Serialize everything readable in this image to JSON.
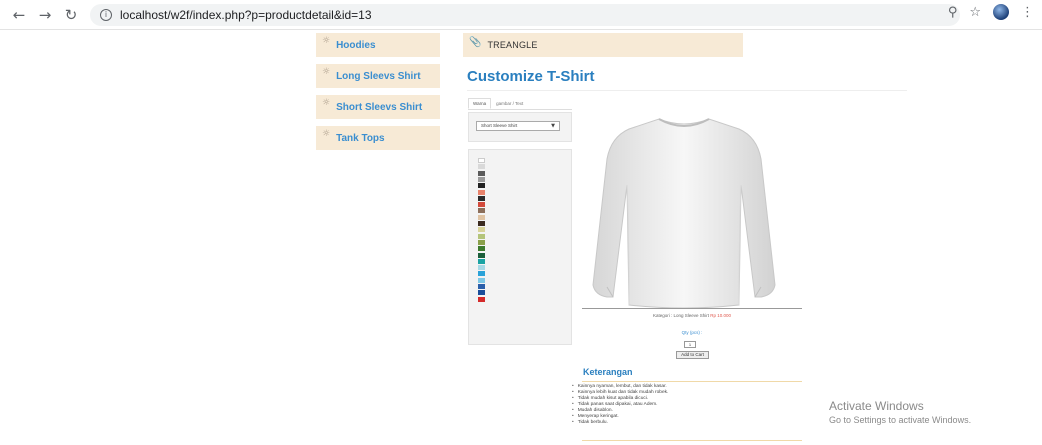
{
  "browser": {
    "url_host": "localhost",
    "url_path": "/w2f/index.php?p=productdetail&id=13"
  },
  "sidebar": {
    "items": [
      {
        "label": "Hoodies"
      },
      {
        "label": "Long Sleevs Shirt"
      },
      {
        "label": "Short Sleevs Shirt"
      },
      {
        "label": "Tank Tops"
      }
    ]
  },
  "breadcrumb": {
    "label": "TREANGLE"
  },
  "main": {
    "title": "Customize T-Shirt",
    "tabs": [
      {
        "label": "Warna"
      },
      {
        "label": "gambar / Text"
      }
    ],
    "select": {
      "value": "Short Sleeve Shirt"
    },
    "swatches": [
      "#ffffff",
      "#d9d9d9",
      "#5a5a5a",
      "#9a9a9a",
      "#222222",
      "#e8826b",
      "#2b2b2b",
      "#d24a3b",
      "#8c6e5a",
      "#e0c4a4",
      "#3b2a20",
      "#d8d39a",
      "#b4c47a",
      "#8aa04a",
      "#3c7a2e",
      "#1b5e3a",
      "#1aa3a3",
      "#a6d9e6",
      "#2aa2d8",
      "#7ec8e6",
      "#2a5faa",
      "#1b4e9a",
      "#d42a2a"
    ],
    "product": {
      "kategori_label": "Kategori : Long Sleeve Shirt",
      "price": "Rp 10.000",
      "qty_label": "Qty (pcs) :",
      "qty_value": "1",
      "add_button": "Add to Cart"
    },
    "keterangan": {
      "title": "Keterangan",
      "items": [
        "Kainnya nyaman, lembut, dan tidak kasar.",
        "Kainnya lebih kuat dan tidak mudah robek.",
        "Tidak mudah kisut apabila dicuci.",
        "Tidak panas saat dipakai, atau Adem.",
        "Mudah disablon.",
        "Menyerap keringat.",
        "Tidak berbulu."
      ]
    }
  },
  "watermark": {
    "line1": "Activate Windows",
    "line2": "Go to Settings to activate Windows."
  }
}
